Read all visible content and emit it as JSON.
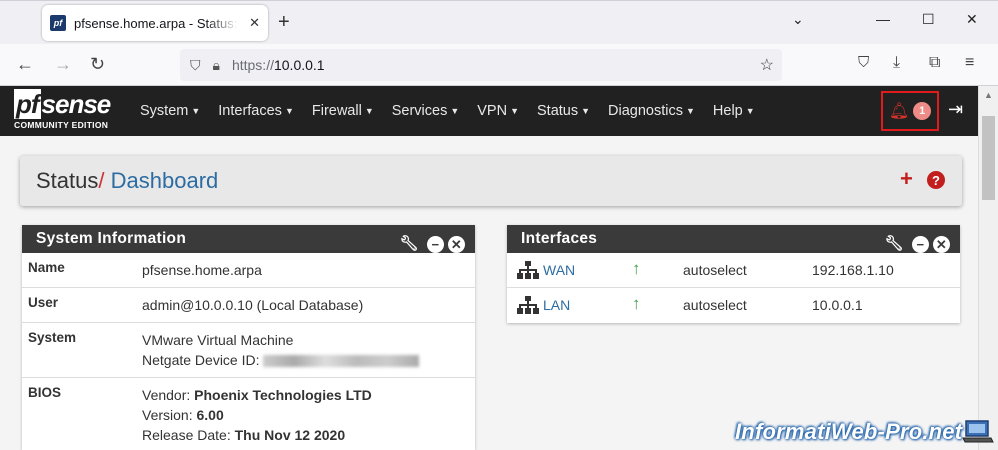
{
  "browser": {
    "tab_title": "pfsense.home.arpa - Status: Dashboard",
    "favicon_text": "pf",
    "url_protocol": "https://",
    "url_host": "10.0.0.1",
    "icons": [
      "back-icon",
      "forward-icon",
      "reload-icon",
      "shield-icon",
      "lock-icon",
      "star-icon",
      "pocket-icon",
      "download-icon",
      "extensions-icon",
      "menu-icon",
      "minimize-icon",
      "maximize-icon",
      "close-icon",
      "new-tab-icon"
    ]
  },
  "pfsense": {
    "logo_main": "pfsense",
    "logo_sub": "COMMUNITY EDITION",
    "menu": [
      "System",
      "Interfaces",
      "Firewall",
      "Services",
      "VPN",
      "Status",
      "Diagnostics",
      "Help"
    ],
    "alert_count": "1",
    "accent_color": "#c31e1e",
    "header_color": "#212121"
  },
  "breadcrumb": {
    "section": "Status",
    "separator": "/",
    "page": "Dashboard"
  },
  "system_info": {
    "title": "System Information",
    "rows": [
      {
        "label": "Name",
        "value": "pfsense.home.arpa"
      },
      {
        "label": "User",
        "value": "admin@10.0.0.10 (Local Database)"
      },
      {
        "label": "System",
        "line1": "VMware Virtual Machine",
        "line2_label": "Netgate Device ID:"
      },
      {
        "label": "BIOS",
        "vendor_label": "Vendor:",
        "vendor": "Phoenix Technologies LTD",
        "version_label": "Version:",
        "version": "6.00",
        "date_label": "Release Date:",
        "date": "Thu Nov 12 2020"
      }
    ]
  },
  "interfaces": {
    "title": "Interfaces",
    "rows": [
      {
        "name": "WAN",
        "status": "up",
        "media": "autoselect",
        "ip": "192.168.1.10"
      },
      {
        "name": "LAN",
        "status": "up",
        "media": "autoselect",
        "ip": "10.0.0.1"
      }
    ]
  },
  "watermark": "InformatiWeb-Pro.net"
}
